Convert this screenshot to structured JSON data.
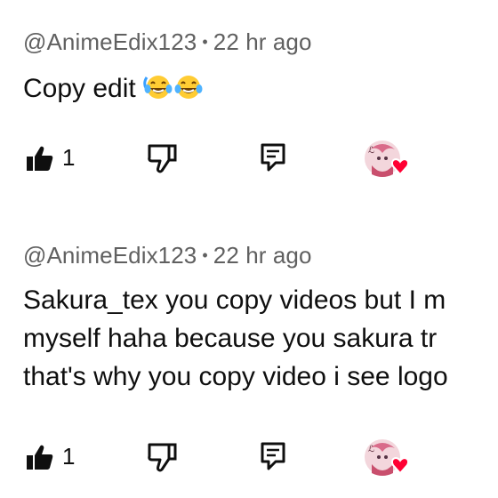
{
  "comments": [
    {
      "author": "@AnimeEdix123",
      "separator": "•",
      "time": "22 hr ago",
      "lines": [
        "Copy edit"
      ],
      "emoji": [
        "face-with-tears-of-joy",
        "face-with-tears-of-joy"
      ],
      "like_count": "1"
    },
    {
      "author": "@AnimeEdix123",
      "separator": "•",
      "time": "22 hr ago",
      "lines": [
        "Sakura_tex you copy videos but I m",
        "myself haha because you sakura tr",
        "that's why you copy video i see logo"
      ],
      "like_count": "1"
    }
  ],
  "icons": {
    "like": "thumbs-up-filled-icon",
    "dislike": "thumbs-down-outline-icon",
    "reply": "reply-comment-icon",
    "creator_heart": "creator-heart-avatar-icon"
  },
  "colors": {
    "meta_text": "#606060",
    "body_text": "#0f0f0f",
    "heart": "#ff0033"
  }
}
